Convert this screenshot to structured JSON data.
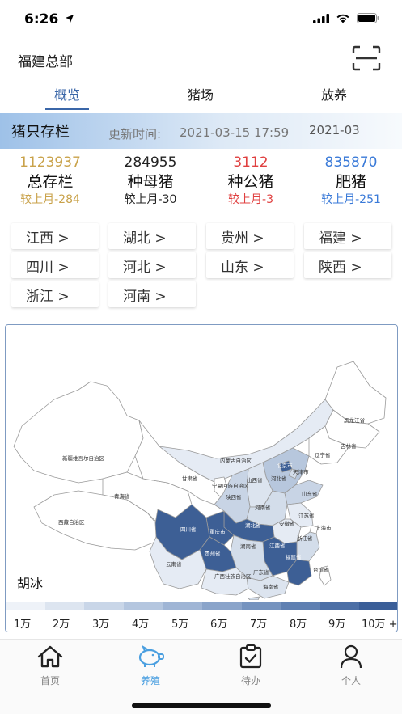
{
  "status_bar": {
    "time": "6:26"
  },
  "header": {
    "org_title": "福建总部"
  },
  "tabs": [
    {
      "label": "概览",
      "active": true
    },
    {
      "label": "猪场",
      "active": false
    },
    {
      "label": "放养",
      "active": false
    }
  ],
  "section": {
    "title": "猪只存栏",
    "update_label": "更新时间:",
    "update_time": "2021-03-15 17:59",
    "month": "2021-03"
  },
  "stats": [
    {
      "value": "1123937",
      "label": "总存栏",
      "change": "较上月-284",
      "color": "#c9a24a"
    },
    {
      "value": "284955",
      "label": "种母猪",
      "change": "较上月-30",
      "color": "#222222"
    },
    {
      "value": "3112",
      "label": "种公猪",
      "change": "较上月-3",
      "color": "#e04040"
    },
    {
      "value": "835870",
      "label": "肥猪",
      "change": "较上月-251",
      "color": "#3a7ad8"
    }
  ],
  "regions": [
    "江西 >",
    "湖北 >",
    "贵州 >",
    "福建 >",
    "四川 >",
    "河北 >",
    "山东 >",
    "陕西 >",
    "浙江 >",
    "河南 >"
  ],
  "map": {
    "user_name": "胡冰",
    "province_labels": {
      "xinjiang": "新疆维吾尔自治区",
      "xizang": "西藏自治区",
      "qinghai": "青海省",
      "gansu": "甘肃省",
      "neimenggu": "内蒙古自治区",
      "heilongjiang": "黑龙江省",
      "jilin": "吉林省",
      "liaoning": "辽宁省",
      "beijing": "北京市",
      "tianjin": "天津市",
      "hebei": "河北省",
      "shanxi": "山西省",
      "shandong": "山东省",
      "ningxia": "宁夏回族自治区",
      "shaanxi": "陕西省",
      "henan": "河南省",
      "jiangsu": "江苏省",
      "anhui": "安徽省",
      "shanghai": "上海市",
      "sichuan": "四川省",
      "chongqing": "重庆市",
      "hubei": "湖北省",
      "zhejiang": "浙江省",
      "hunan": "湖南省",
      "jiangxi": "江西省",
      "guizhou": "贵州省",
      "fujian": "福建省",
      "yunnan": "云南省",
      "guangxi": "广西壮族自治区",
      "guangdong": "广东省",
      "taiwan": "台湾省",
      "hainan": "海南省"
    },
    "legend": [
      "1万",
      "2万",
      "3万",
      "4万",
      "5万",
      "6万",
      "7万",
      "8万",
      "9万",
      "10万 +"
    ],
    "legend_colors": [
      "#eef2f8",
      "#dde5f0",
      "#c9d6e8",
      "#b4c6df",
      "#9fb5d5",
      "#8aa4ca",
      "#7593bf",
      "#5f80b2",
      "#4c6fa6",
      "#3b5f99"
    ]
  },
  "bottom_nav": [
    {
      "label": "首页",
      "icon": "home-icon",
      "active": false
    },
    {
      "label": "养殖",
      "icon": "piggy-icon",
      "active": true
    },
    {
      "label": "待办",
      "icon": "clipboard-check-icon",
      "active": false
    },
    {
      "label": "个人",
      "icon": "person-icon",
      "active": false
    }
  ]
}
